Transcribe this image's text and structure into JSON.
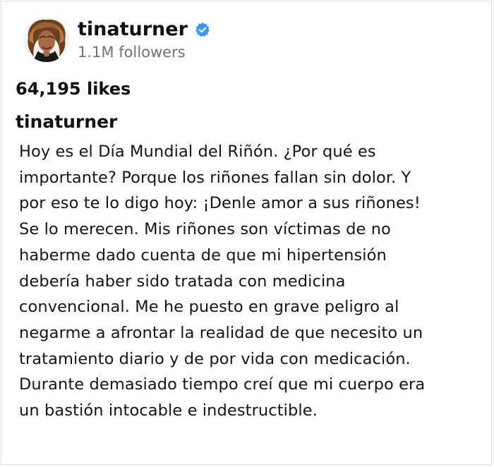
{
  "post": {
    "username": "tinaturner",
    "followers": "1.1M followers",
    "likes": "64,195 likes",
    "caption_username": "tinaturner",
    "caption_lines": [
      "Hoy es el Día Mundial del Riñón. ¿Por qué es",
      "importante? Porque los riñones fallan sin dolor. Y",
      "por eso te lo digo hoy: ¡Denle amor a sus riñones!",
      "Se lo merecen. Mis riñones son víctimas de no",
      "haberme dado cuenta de que mi hipertensión",
      "debería haber sido tratada con medicina",
      "convencional. Me he puesto en grave peligro al",
      "negarme a afrontar la realidad de que necesito un",
      "tratamiento diario y de por vida con medicación.",
      "Durante demasiado tiempo creí que mi cuerpo era",
      "un bastión intocable e indestructible."
    ]
  },
  "icons": {
    "verified": "verified-badge-icon",
    "avatar": "profile-avatar"
  },
  "colors": {
    "verified_blue": "#3897f0",
    "secondary_text": "#737373",
    "primary_text": "#111111"
  }
}
